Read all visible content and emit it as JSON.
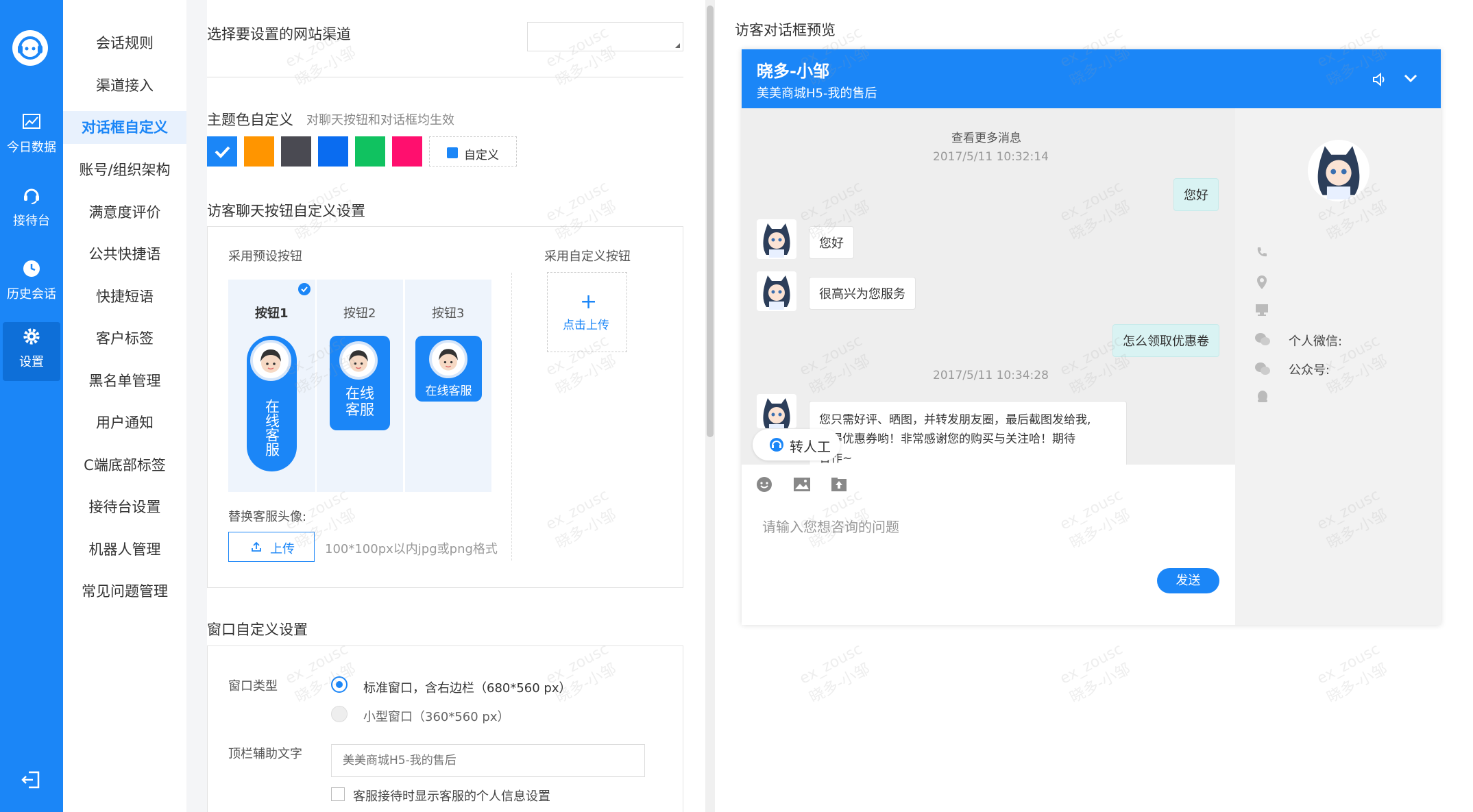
{
  "rail": {
    "items": [
      {
        "label": "今日数据",
        "icon": "chart-icon"
      },
      {
        "label": "接待台",
        "icon": "headset-icon"
      },
      {
        "label": "历史会话",
        "icon": "clock-icon"
      },
      {
        "label": "设置",
        "icon": "gear-icon"
      }
    ]
  },
  "nav": {
    "items": [
      "会话规则",
      "渠道接入",
      "对话框自定义",
      "账号/组织架构",
      "满意度评价",
      "公共快捷语",
      "快捷短语",
      "客户标签",
      "黑名单管理",
      "用户通知",
      "C端底部标签",
      "接待台设置",
      "机器人管理",
      "常见问题管理"
    ],
    "active": "对话框自定义"
  },
  "settings": {
    "channel_label": "选择要设置的网站渠道",
    "theme_title": "主题色自定义",
    "theme_hint": "对聊天按钮和对话框均生效",
    "theme_colors": [
      "#1b86f7",
      "#ff9500",
      "#4a4a52",
      "#0a6cf0",
      "#10c260",
      "#ff0f6e"
    ],
    "custom_color_label": "自定义",
    "button_section_title": "访客聊天按钮自定义设置",
    "preset_label": "采用预设按钮",
    "custom_label": "采用自定义按钮",
    "presets": [
      {
        "name": "按钮1",
        "text": "在线客服"
      },
      {
        "name": "按钮2",
        "text": "在线客服"
      },
      {
        "name": "按钮3",
        "text": "在线客服"
      }
    ],
    "upload_click": "点击上传",
    "replace_avatar_label": "替换客服头像:",
    "upload_button": "上传",
    "upload_hint": "100*100px以内jpg或png格式",
    "window_section_title": "窗口自定义设置",
    "window_type_label": "窗口类型",
    "window_options": [
      "标准窗口，含右边栏（680*560 px）",
      "小型窗口（360*560 px）"
    ],
    "topbar_text_label": "顶栏辅助文字",
    "topbar_text_placeholder": "美美商城H5-我的售后",
    "show_profile_label": "客服接待时显示客服的个人信息设置"
  },
  "preview": {
    "title": "访客对话框预览",
    "agent_name": "晓多-小邹",
    "subtitle": "美美商城H5-我的售后",
    "more_messages": "查看更多消息",
    "messages": [
      {
        "type": "time",
        "text": "2017/5/11 10:32:14"
      },
      {
        "type": "visitor",
        "text": "您好"
      },
      {
        "type": "agent",
        "text": "您好"
      },
      {
        "type": "agent",
        "text": "很高兴为您服务"
      },
      {
        "type": "visitor",
        "text": "怎么领取优惠卷"
      },
      {
        "type": "time",
        "text": "2017/5/11 10:34:28"
      },
      {
        "type": "agent",
        "lines": [
          "您只需好评、晒图，并转发朋友圈，最后截图发给我,",
          "获得优惠券哟！非常感谢您的购买与关注哈！期待",
          "合作~"
        ]
      }
    ],
    "transfer_label": "转人工",
    "input_placeholder": "请输入您想咨询的问题",
    "send_label": "发送",
    "side_labels": {
      "wechat_personal": "个人微信:",
      "wechat_official": "公众号:"
    }
  },
  "watermark": {
    "line1": "ex_zousc",
    "line2": "晓多-小邹"
  }
}
